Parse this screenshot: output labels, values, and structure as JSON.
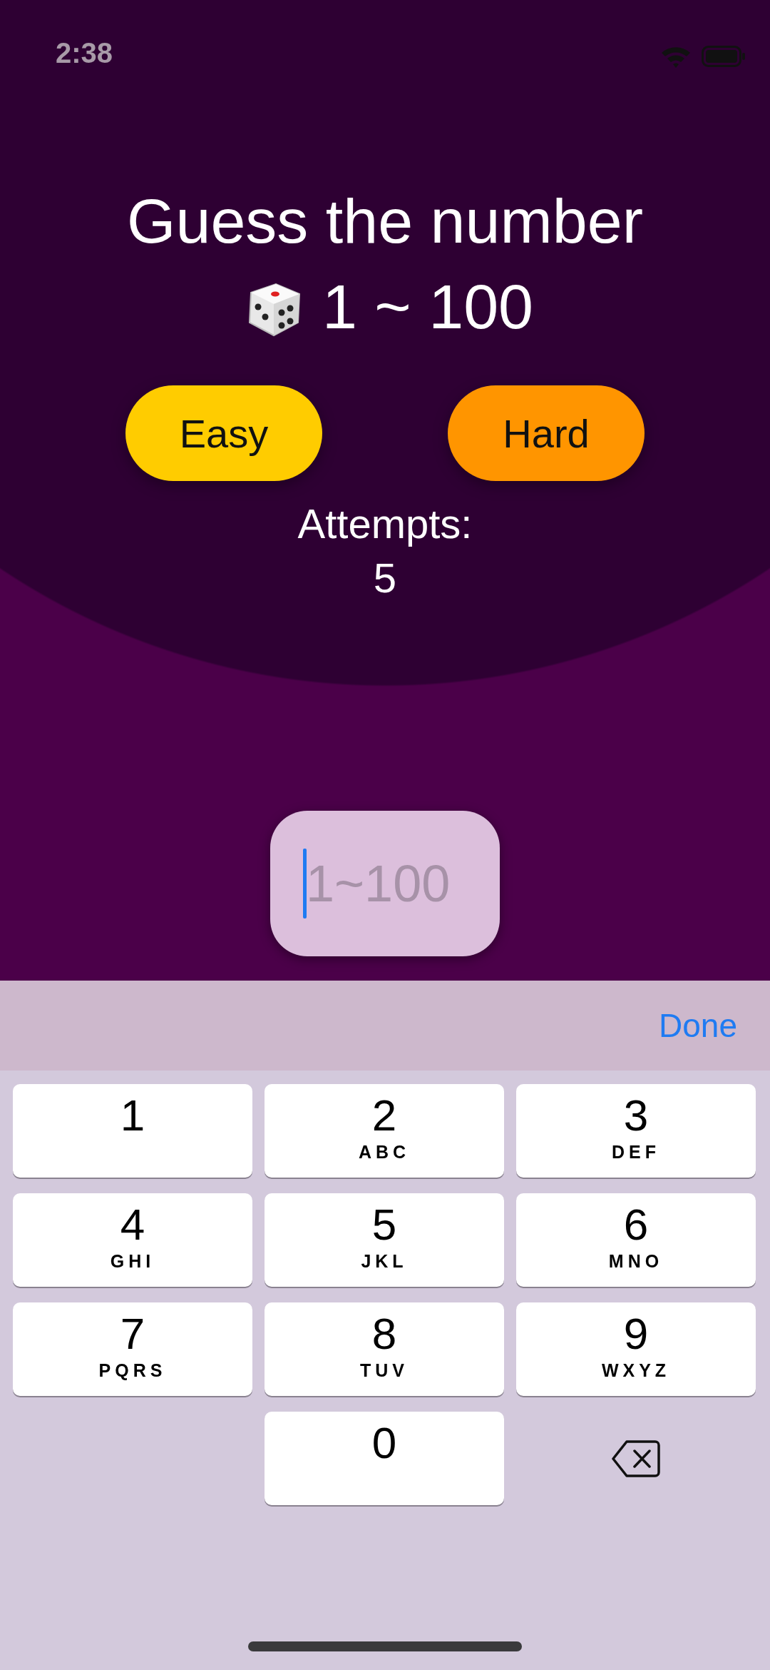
{
  "status_bar": {
    "time": "2:38"
  },
  "title": "Guess the number",
  "range": "1 ~ 100",
  "modes": [
    {
      "label": "Easy",
      "color": "#ffcc00"
    },
    {
      "label": "Hard",
      "color": "#ff9500"
    }
  ],
  "attempts": {
    "label": "Attempts:",
    "value": "5"
  },
  "guess_field": {
    "placeholder": "1~100",
    "focused": true
  },
  "keyboard": {
    "done": "Done",
    "keys": [
      {
        "kind": "digit",
        "digit": "1"
      },
      {
        "kind": "digit",
        "digit": "2",
        "letters": "ABC"
      },
      {
        "kind": "digit",
        "digit": "3",
        "letters": "DEF"
      },
      {
        "kind": "digit",
        "digit": "4",
        "letters": "GHI"
      },
      {
        "kind": "digit",
        "digit": "5",
        "letters": "JKL"
      },
      {
        "kind": "digit",
        "digit": "6",
        "letters": "MNO"
      },
      {
        "kind": "digit",
        "digit": "7",
        "letters": "PQRS"
      },
      {
        "kind": "digit",
        "digit": "8",
        "letters": "TUV"
      },
      {
        "kind": "digit",
        "digit": "9",
        "letters": "WXYZ"
      },
      {
        "kind": "blank"
      },
      {
        "kind": "digit",
        "digit": "0"
      },
      {
        "kind": "delete"
      }
    ]
  }
}
